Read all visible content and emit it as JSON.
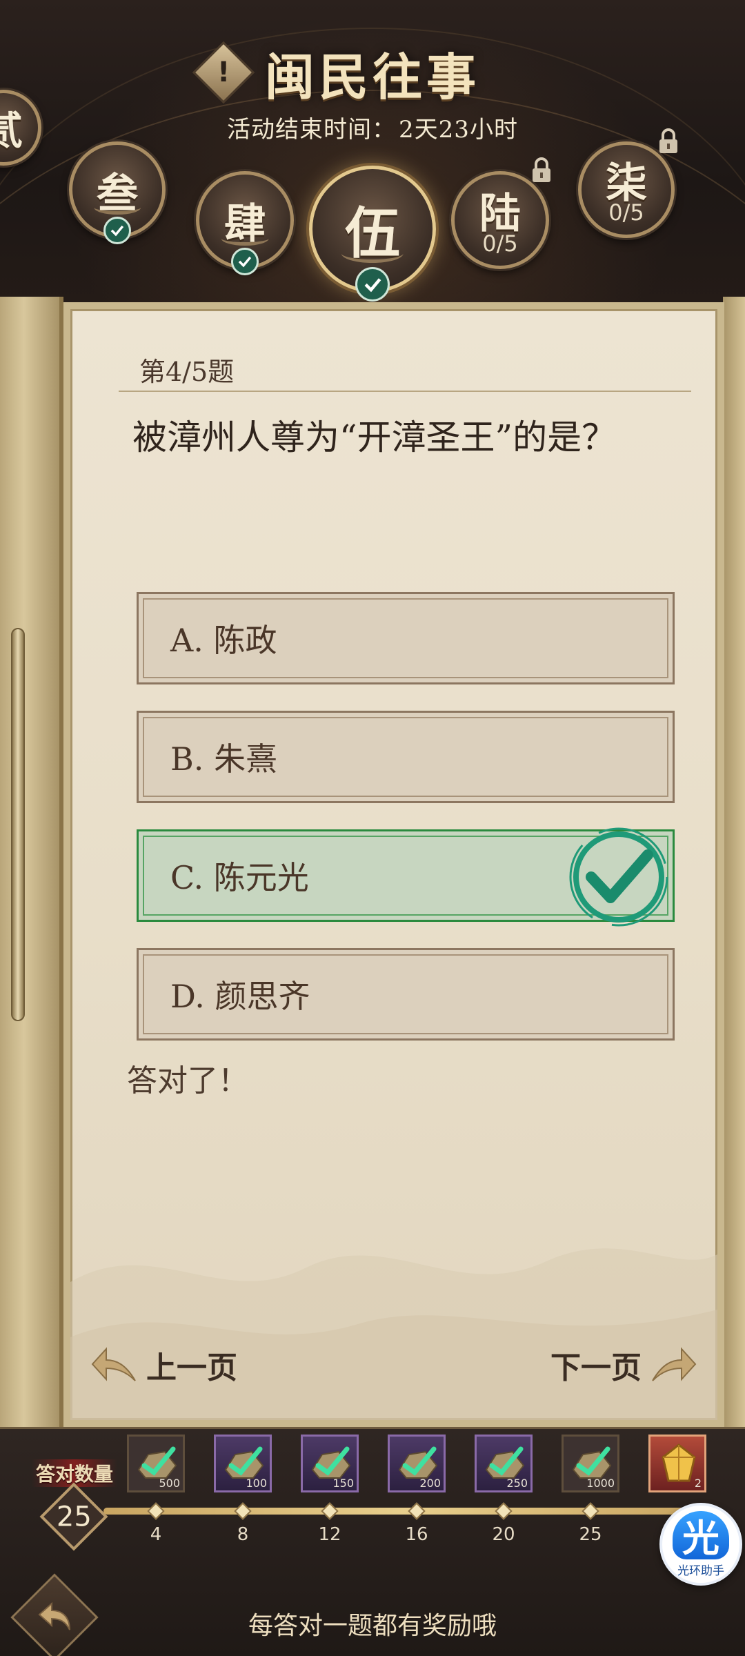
{
  "header": {
    "title": "闽民往事",
    "info_icon": "!",
    "timer_label": "活动结束时间：",
    "timer_value": "2天23小时"
  },
  "chapters": [
    {
      "glyph": "贰",
      "status": "done"
    },
    {
      "glyph": "叁",
      "status": "done"
    },
    {
      "glyph": "肆",
      "status": "done"
    },
    {
      "glyph": "伍",
      "status": "done",
      "active": true
    },
    {
      "glyph": "陆",
      "status": "locked",
      "progress": "0/5"
    },
    {
      "glyph": "柒",
      "status": "locked",
      "progress": "0/5"
    }
  ],
  "quiz": {
    "counter": "第4/5题",
    "question": "被漳州人尊为“开漳圣王”的是？",
    "options": [
      {
        "label": "A. 陈政",
        "correct": false
      },
      {
        "label": "B. 朱熹",
        "correct": false
      },
      {
        "label": "C. 陈元光",
        "correct": true
      },
      {
        "label": "D. 颜思齐",
        "correct": false
      }
    ],
    "feedback": "答对了！",
    "prev_label": "上一页",
    "next_label": "下一页"
  },
  "rewards": {
    "count_label": "答对数量",
    "count_value": "25",
    "items": [
      {
        "qty": "500",
        "milestone": "4",
        "style": "normal",
        "icon": "gem-ore-icon"
      },
      {
        "qty": "100",
        "milestone": "8",
        "style": "purple",
        "icon": "gem-ore-icon"
      },
      {
        "qty": "150",
        "milestone": "12",
        "style": "purple",
        "icon": "gem-ore-icon"
      },
      {
        "qty": "200",
        "milestone": "16",
        "style": "purple",
        "icon": "gem-ore-icon"
      },
      {
        "qty": "250",
        "milestone": "20",
        "style": "purple",
        "icon": "gem-ore-icon"
      },
      {
        "qty": "1000",
        "milestone": "25",
        "style": "normal",
        "icon": "gem-ore-icon"
      },
      {
        "qty": "2",
        "milestone": "",
        "style": "gold",
        "icon": "golden-crystal-icon"
      }
    ],
    "hint": "每答对一题都有奖励哦"
  },
  "assistant": {
    "big": "光",
    "small": "光环助手"
  },
  "colors": {
    "correct_green": "#2a8a3e",
    "badge_green": "#1f5f4c",
    "parchment": "#ede4d2",
    "gold_frame": "#c9b88e"
  }
}
